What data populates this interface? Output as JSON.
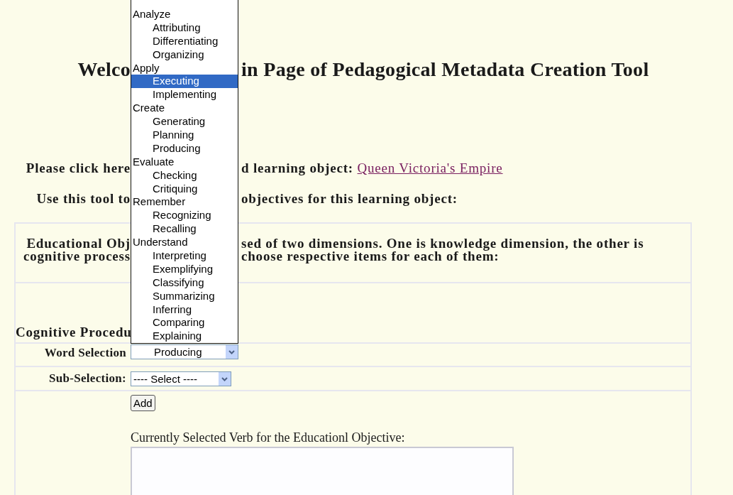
{
  "title": {
    "left": "Welco",
    "right": "in Page of Pedagogical Metadata Creation Tool"
  },
  "intro": {
    "left": "Please click here",
    "right": "d learning object:",
    "link": "Queen Victoria's Empire"
  },
  "instruction": {
    "left": "Use this tool to",
    "right": "objectives for this learning object:"
  },
  "description": [
    {
      "left": "Educational Obj",
      "right": "sed of two dimensions. One is knowledge dimension, the other is"
    },
    {
      "left": "cognitive process",
      "right": "choose respective items for each of them:"
    }
  ],
  "section_label": "Cognitive Procedu",
  "dropdown_list": [
    {
      "label": "Analyze",
      "children": [
        {
          "label": "Attributing",
          "selected": false
        },
        {
          "label": "Differentiating",
          "selected": false
        },
        {
          "label": "Organizing",
          "selected": false
        }
      ]
    },
    {
      "label": "Apply",
      "children": [
        {
          "label": "Executing",
          "selected": true
        },
        {
          "label": "Implementing",
          "selected": false
        }
      ]
    },
    {
      "label": "Create",
      "children": [
        {
          "label": "Generating",
          "selected": false
        },
        {
          "label": "Planning",
          "selected": false
        },
        {
          "label": "Producing",
          "selected": false
        }
      ]
    },
    {
      "label": "Evaluate",
      "children": [
        {
          "label": "Checking",
          "selected": false
        },
        {
          "label": "Critiquing",
          "selected": false
        }
      ]
    },
    {
      "label": "Remember",
      "children": [
        {
          "label": "Recognizing",
          "selected": false
        },
        {
          "label": "Recalling",
          "selected": false
        }
      ]
    },
    {
      "label": "Understand",
      "children": [
        {
          "label": "Interpreting",
          "selected": false
        },
        {
          "label": "Exemplifying",
          "selected": false
        },
        {
          "label": "Classifying",
          "selected": false
        },
        {
          "label": "Summarizing",
          "selected": false
        },
        {
          "label": "Inferring",
          "selected": false
        },
        {
          "label": "Comparing",
          "selected": false
        },
        {
          "label": "Explaining",
          "selected": false
        }
      ]
    }
  ],
  "word_selection": {
    "label": "Word Selection",
    "value": "Producing"
  },
  "sub_selection": {
    "label": "Sub-Selection:",
    "value": "---- Select ----"
  },
  "add_button": "Add",
  "selected_verb": {
    "label": "Currently Selected Verb for the Educationl Objective:"
  }
}
